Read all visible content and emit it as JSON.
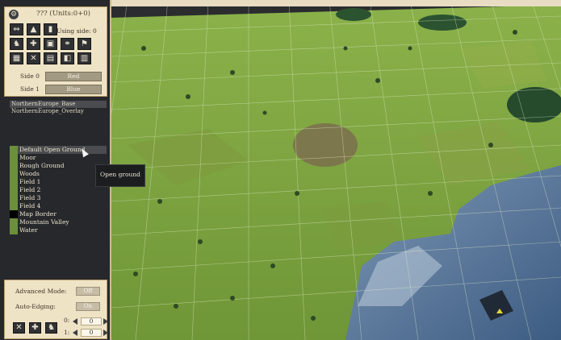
{
  "header": {
    "title": "??? (Units:0+0)",
    "using_side": "Using side: 0"
  },
  "sides": [
    {
      "label": "Side 0",
      "value": "Red"
    },
    {
      "label": "Side 1",
      "value": "Blue"
    }
  ],
  "layers": [
    "NorthernEurope_Base",
    "NorthernEurope_Overlay"
  ],
  "terrain": [
    {
      "label": "Default Open Ground",
      "color": "#6c8f3c"
    },
    {
      "label": "Moor",
      "color": "#6c8f3c"
    },
    {
      "label": "Rough Ground",
      "color": "#6c8f3c"
    },
    {
      "label": "Woods",
      "color": "#6c8f3c"
    },
    {
      "label": "Field 1",
      "color": "#6c8f3c"
    },
    {
      "label": "Field 2",
      "color": "#6c8f3c"
    },
    {
      "label": "Field 3",
      "color": "#6c8f3c"
    },
    {
      "label": "Field 4",
      "color": "#6c8f3c"
    },
    {
      "label": "Map Border",
      "color": "#000000"
    },
    {
      "label": "Mountain Valley",
      "color": "#6c8f3c"
    },
    {
      "label": "Water",
      "color": "#6c8f3c"
    }
  ],
  "tooltip": "Open ground",
  "options": {
    "advanced_label": "Advanced Mode:",
    "advanced_value": "Off",
    "auto_label": "Auto-Edging:",
    "auto_value": "On"
  },
  "counters": [
    {
      "label": "0:",
      "value": "0"
    },
    {
      "label": "1:",
      "value": "0"
    }
  ]
}
